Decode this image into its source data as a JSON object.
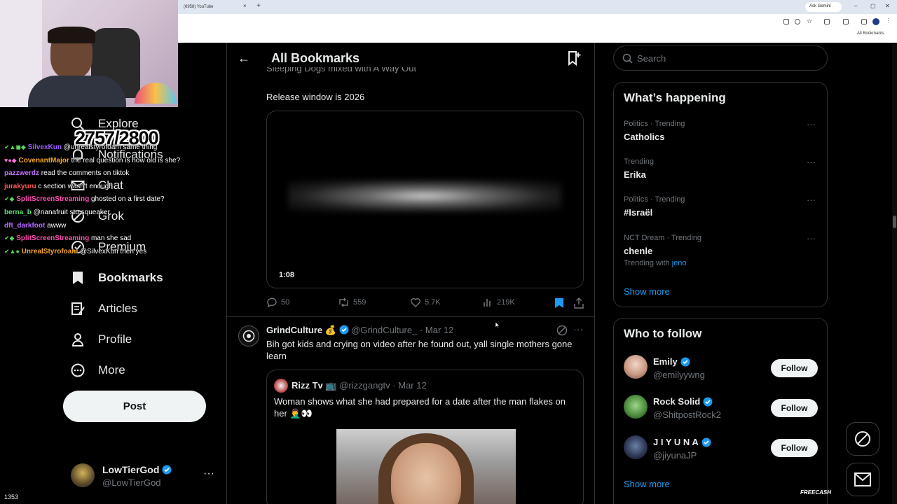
{
  "browser": {
    "tab_title": "(6958) YouTube",
    "tab_close": "×",
    "new_tab": "+",
    "ask_button": "Ask Gemini",
    "window_controls": [
      "–",
      "▢",
      "✕"
    ],
    "bookmarks_folder": "All Bookmarks"
  },
  "stream_overlay": {
    "counter": "2757/2800",
    "viewer_count": "1353",
    "sponsor": "FREECASH",
    "chat": [
      {
        "badges": "✔▲◼◆",
        "user": "SilvexKun",
        "user_color": "#9b59ff",
        "message": "@unrealstyrofoam same thing"
      },
      {
        "badges": "♥●◆",
        "user": "CovenantMajor",
        "user_color": "#f5a623",
        "message": "the real question is how old is she?"
      },
      {
        "badges": "",
        "user": "pazzwerdz",
        "user_color": "#c471ff",
        "message": "read the comments on tiktok"
      },
      {
        "badges": "",
        "user": "jurakyuru",
        "user_color": "#ff5a5a",
        "message": "c section wasn't enough"
      },
      {
        "badges": "✔◆",
        "user": "SplitScreenStreaming",
        "user_color": "#ff4fb3",
        "message": "ghosted on a first date?"
      },
      {
        "badges": "",
        "user": "berna_b",
        "user_color": "#5ce07a",
        "message": "@nanafruit stu squeaker"
      },
      {
        "badges": "",
        "user": "dft_darkfoot",
        "user_color": "#b967ff",
        "message": "awww"
      },
      {
        "badges": "✔◆",
        "user": "SplitScreenStreaming",
        "user_color": "#ff4fb3",
        "message": "man she sad"
      },
      {
        "badges": "✔▲●",
        "user": "UnrealStyrofoam",
        "user_color": "#f5a623",
        "message": "@SilvexKun then yes"
      }
    ]
  },
  "nav": {
    "items": [
      {
        "label": "Explore"
      },
      {
        "label": "Notifications"
      },
      {
        "label": "Chat"
      },
      {
        "label": "Grok"
      },
      {
        "label": "Premium"
      },
      {
        "label": "Bookmarks"
      },
      {
        "label": "Articles"
      },
      {
        "label": "Profile"
      },
      {
        "label": "More"
      }
    ],
    "post_label": "Post"
  },
  "account": {
    "name": "LowTierGod",
    "handle": "@LowTierGod",
    "more": "···"
  },
  "main": {
    "back": "←",
    "title": "All Bookmarks",
    "tweet1": {
      "cut_text": "Sleeping Dogs mixed with A Way Out",
      "text": "Release window is 2026",
      "video_time": "1:08",
      "replies": "50",
      "reposts": "559",
      "likes": "5.7K",
      "views": "219K"
    },
    "tweet2": {
      "name": "GrindCulture 💰",
      "handle": "@GrindCulture_",
      "date": "· Mar 12",
      "text": "Bih got kids and crying on video after he found out, yall single mothers gone learn",
      "more": "···",
      "quote": {
        "name": "Rizz Tv 📺",
        "handle": "@rizzgangtv",
        "date": "· Mar 12",
        "text": "Woman shows what she had prepared for a date after the man flakes on her 🤦‍♂️👀"
      }
    }
  },
  "sidebar": {
    "search_placeholder": "Search",
    "trending": {
      "title": "What’s happening",
      "items": [
        {
          "meta": "Politics · Trending",
          "name": "Catholics"
        },
        {
          "meta": "Trending",
          "name": "Erika"
        },
        {
          "meta": "Politics · Trending",
          "name": "#Israël"
        },
        {
          "meta": "NCT Dream · Trending",
          "name": "chenle",
          "with_label": "Trending with",
          "with_value": "jeno"
        }
      ],
      "more": "···",
      "show_more": "Show more"
    },
    "who_to_follow": {
      "title": "Who to follow",
      "users": [
        {
          "name": "Emily",
          "handle": "@emilyywng"
        },
        {
          "name": "Rock Solid",
          "handle": "@ShitpostRock2"
        },
        {
          "name": "J I Y U N A",
          "handle": "@jiyunaJP"
        }
      ],
      "follow_label": "Follow",
      "show_more": "Show more"
    }
  },
  "colors": {
    "accent": "#1d9bf0",
    "background": "#000000",
    "border": "#2f3336",
    "muted": "#71767b"
  }
}
